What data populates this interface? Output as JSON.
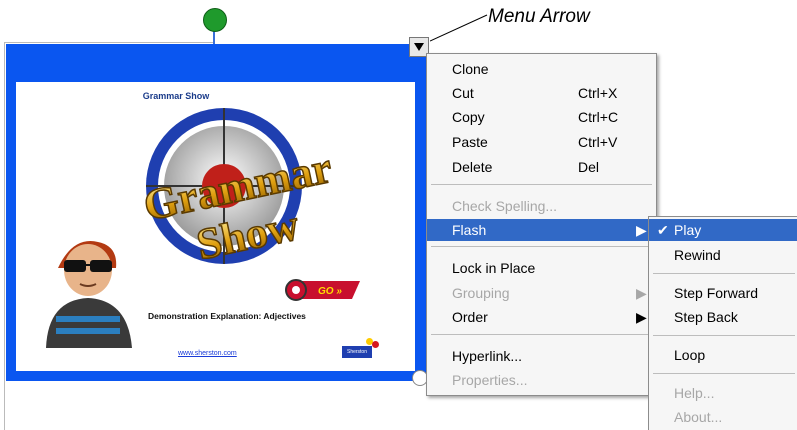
{
  "callout": {
    "text": "Menu Arrow"
  },
  "slide": {
    "title": "Grammar Show",
    "logo_line1": "Grammar",
    "logo_line2": "Show",
    "go_label": "GO »",
    "subtitle": "Demonstration Explanation: Adjectives",
    "link": "www.sherston.com",
    "badge": "Sherston"
  },
  "context_menu": {
    "items": [
      {
        "label": "Clone",
        "shortcut": ""
      },
      {
        "label": "Cut",
        "shortcut": "Ctrl+X"
      },
      {
        "label": "Copy",
        "shortcut": "Ctrl+C"
      },
      {
        "label": "Paste",
        "shortcut": "Ctrl+V"
      },
      {
        "label": "Delete",
        "shortcut": "Del"
      },
      {
        "label": "Check Spelling...",
        "shortcut": ""
      },
      {
        "label": "Flash",
        "shortcut": ""
      },
      {
        "label": "Lock in Place",
        "shortcut": ""
      },
      {
        "label": "Grouping",
        "shortcut": ""
      },
      {
        "label": "Order",
        "shortcut": ""
      },
      {
        "label": "Hyperlink...",
        "shortcut": ""
      },
      {
        "label": "Properties...",
        "shortcut": ""
      }
    ]
  },
  "flash_submenu": {
    "items": [
      {
        "label": "Play"
      },
      {
        "label": "Rewind"
      },
      {
        "label": "Step Forward"
      },
      {
        "label": "Step Back"
      },
      {
        "label": "Loop"
      },
      {
        "label": "Help..."
      },
      {
        "label": "About..."
      }
    ]
  },
  "colors": {
    "frame_blue": "#0a56f0",
    "highlight": "#3169c6",
    "disabled": "#a7a7a7"
  }
}
